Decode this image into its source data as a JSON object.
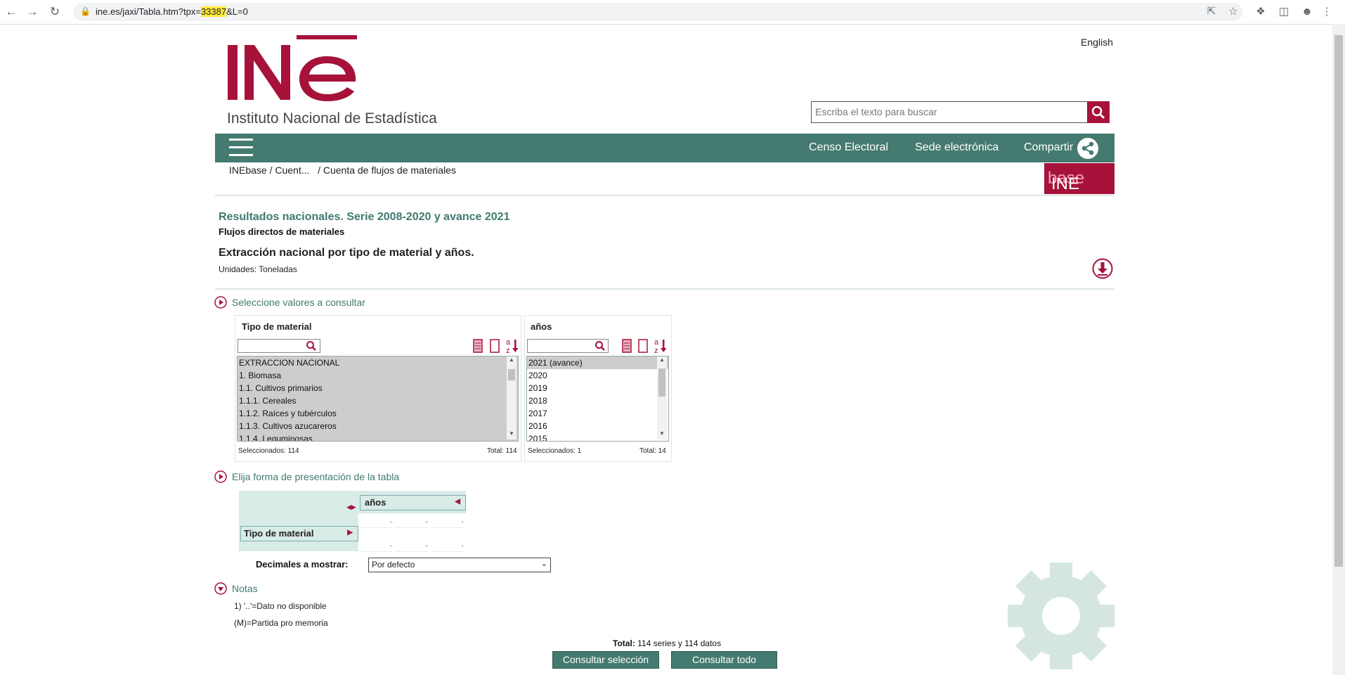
{
  "browser": {
    "url_prefix": "ine.es/jaxi/Tabla.htm?tpx=",
    "url_highlight": "33387",
    "url_suffix": "&L=0"
  },
  "header": {
    "language_link": "English",
    "logo_text": "INE",
    "logo_subtitle": "Instituto Nacional de Estadística",
    "search_placeholder": "Escriba el texto para buscar"
  },
  "navbar": {
    "links": [
      "Censo Electoral",
      "Sede electrónica",
      "Compartir"
    ]
  },
  "breadcrumb": {
    "item1": "INEbase",
    "item2": "/ Cuent...",
    "item3": "/ Cuenta de flujos de materiales"
  },
  "inebase_logo": {
    "part1": "INE",
    "part2": "base"
  },
  "content": {
    "series_title": "Resultados nacionales. Serie 2008-2020 y avance 2021",
    "series_subtitle": "Flujos directos de materiales",
    "table_title": "Extracción nacional por tipo de material y años.",
    "units": "Unidades: Toneladas"
  },
  "select_section": {
    "label": "Seleccione valores a consultar",
    "panels": [
      {
        "title": "Tipo de material",
        "items": [
          "EXTRACCION NACIONAL",
          "1. Biomasa",
          "1.1. Cultivos primarios",
          "1.1.1. Cereales",
          "1.1.2. Raíces y tubérculos",
          "1.1.3. Cultivos azucareros",
          "1.1.4. Leguminosas"
        ],
        "selected_label": "Seleccionados: 114",
        "total_label": "Total: 114"
      },
      {
        "title": "años",
        "items": [
          "2021 (avance)",
          "2020",
          "2019",
          "2018",
          "2017",
          "2016",
          "2015"
        ],
        "selected_label": "Seleccionados: 1",
        "total_label": "Total: 14"
      }
    ]
  },
  "layout_section": {
    "label": "Elija forma de presentación de la tabla",
    "column_dim": "años",
    "row_dim": "Tipo de material",
    "cell_placeholder": ".",
    "decimals_label": "Decimales a mostrar:",
    "decimals_value": "Por defecto"
  },
  "notes_section": {
    "label": "Notas",
    "notes": [
      "1) '..'=Dato no disponible",
      "(M)=Partida pro memoria"
    ]
  },
  "footer": {
    "total_label": "Total:",
    "total_text": "114 series y  114 datos",
    "btn_selection": "Consultar selección",
    "btn_all": "Consultar todo"
  },
  "colors": {
    "brand_red": "#a6123a",
    "brand_teal": "#457a70"
  }
}
